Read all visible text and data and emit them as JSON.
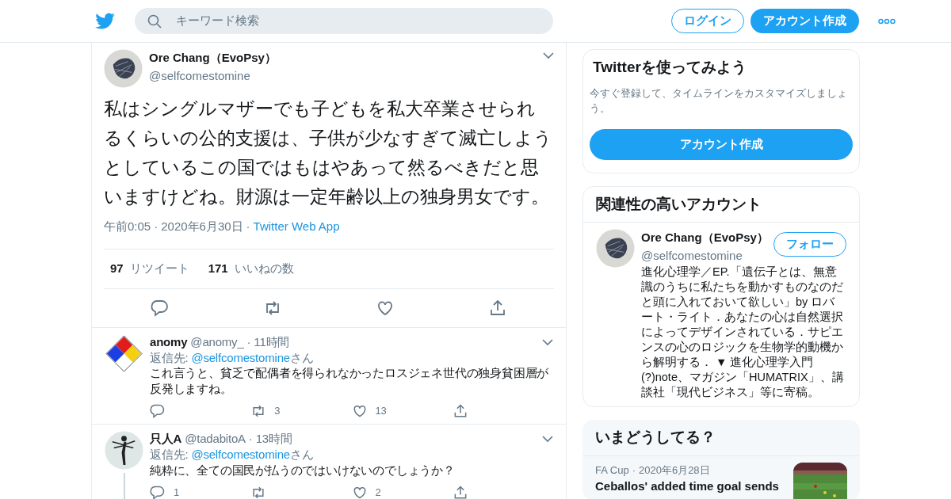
{
  "header": {
    "search": {
      "placeholder": "キーワード検索"
    },
    "login": "ログイン",
    "signup": "アカウント作成"
  },
  "main_tweet": {
    "avatar": {
      "kind": "scribble"
    },
    "name": "Ore Chang（EvoPsy）",
    "handle": "@selfcomestomine",
    "text": "私はシングルマザーでも子どもを私大卒業させられるくらいの公的支援は、子供が少なすぎて滅亡しようとしているこの国ではもはやあって然るべきだと思いますけどね。財源は一定年齢以上の独身男女です。",
    "meta": [
      {
        "kind": "text",
        "text": "午前0:05"
      },
      {
        "kind": "dot",
        "text": "·"
      },
      {
        "kind": "text",
        "text": "2020年6月30日"
      },
      {
        "kind": "dot",
        "text": "·"
      },
      {
        "kind": "link",
        "text": "Twitter Web App"
      }
    ],
    "retweets": {
      "count": "97",
      "label": "リツイート"
    },
    "likes": {
      "count": "171",
      "label": "いいねの数"
    }
  },
  "replies": [
    {
      "avatar": {
        "kind": "diamond"
      },
      "name": "anomy",
      "handle": "@anomy_",
      "dot": "·",
      "age": "11時間",
      "reply_to_label": "返信先:",
      "reply_to": "@selfcomestomine",
      "reply_to_suffix": "さん",
      "text": "これ言うと、貧乏で配偶者を得られなかったロスジェネ世代の独身貧困層が反発しますね。",
      "retweet_count": "3",
      "like_count": "13",
      "thread_line": false
    },
    {
      "avatar": {
        "kind": "figure"
      },
      "name": "只人A",
      "handle": "@tadabitoA",
      "dot": "·",
      "age": "13時間",
      "reply_to_label": "返信先:",
      "reply_to": "@selfcomestomine",
      "reply_to_suffix": "さん",
      "text": "純粋に、全ての国民が払うのではいけないのでしょうか？",
      "reply_count": "1",
      "like_count": "2",
      "thread_line": true
    }
  ],
  "sidebar": {
    "signup_card": {
      "title": "Twitterを使ってみよう",
      "text": "今すぐ登録して、タイムラインをカスタマイズしましょう。",
      "button": "アカウント作成"
    },
    "related": {
      "title": "関連性の高いアカウント",
      "accounts": [
        {
          "avatar": {
            "kind": "scribble"
          },
          "name": "Ore Chang（EvoPsy）",
          "handle": "@selfcomestomine",
          "follow": "フォロー",
          "bio": "進化心理学／EP.「遺伝子とは、無意識のうちに私たちを動かすものなのだと頭に入れておいて欲しい」by ロバート・ライト．あなたの心は自然選択によってデザインされている．サピエンスの心のロジックを生物学的動機から解明する． ▼ 進化心理学入門(?)note、マガジン「HUMATRIX」、講談社「現代ビジネス」等に寄稿。"
        }
      ]
    },
    "trends": {
      "title": "いまどうしてる？",
      "items": [
        {
          "source": "FA Cup",
          "dot": "·",
          "date": "2020年6月28日",
          "headline": "Ceballos' added time goal sends"
        }
      ]
    }
  }
}
